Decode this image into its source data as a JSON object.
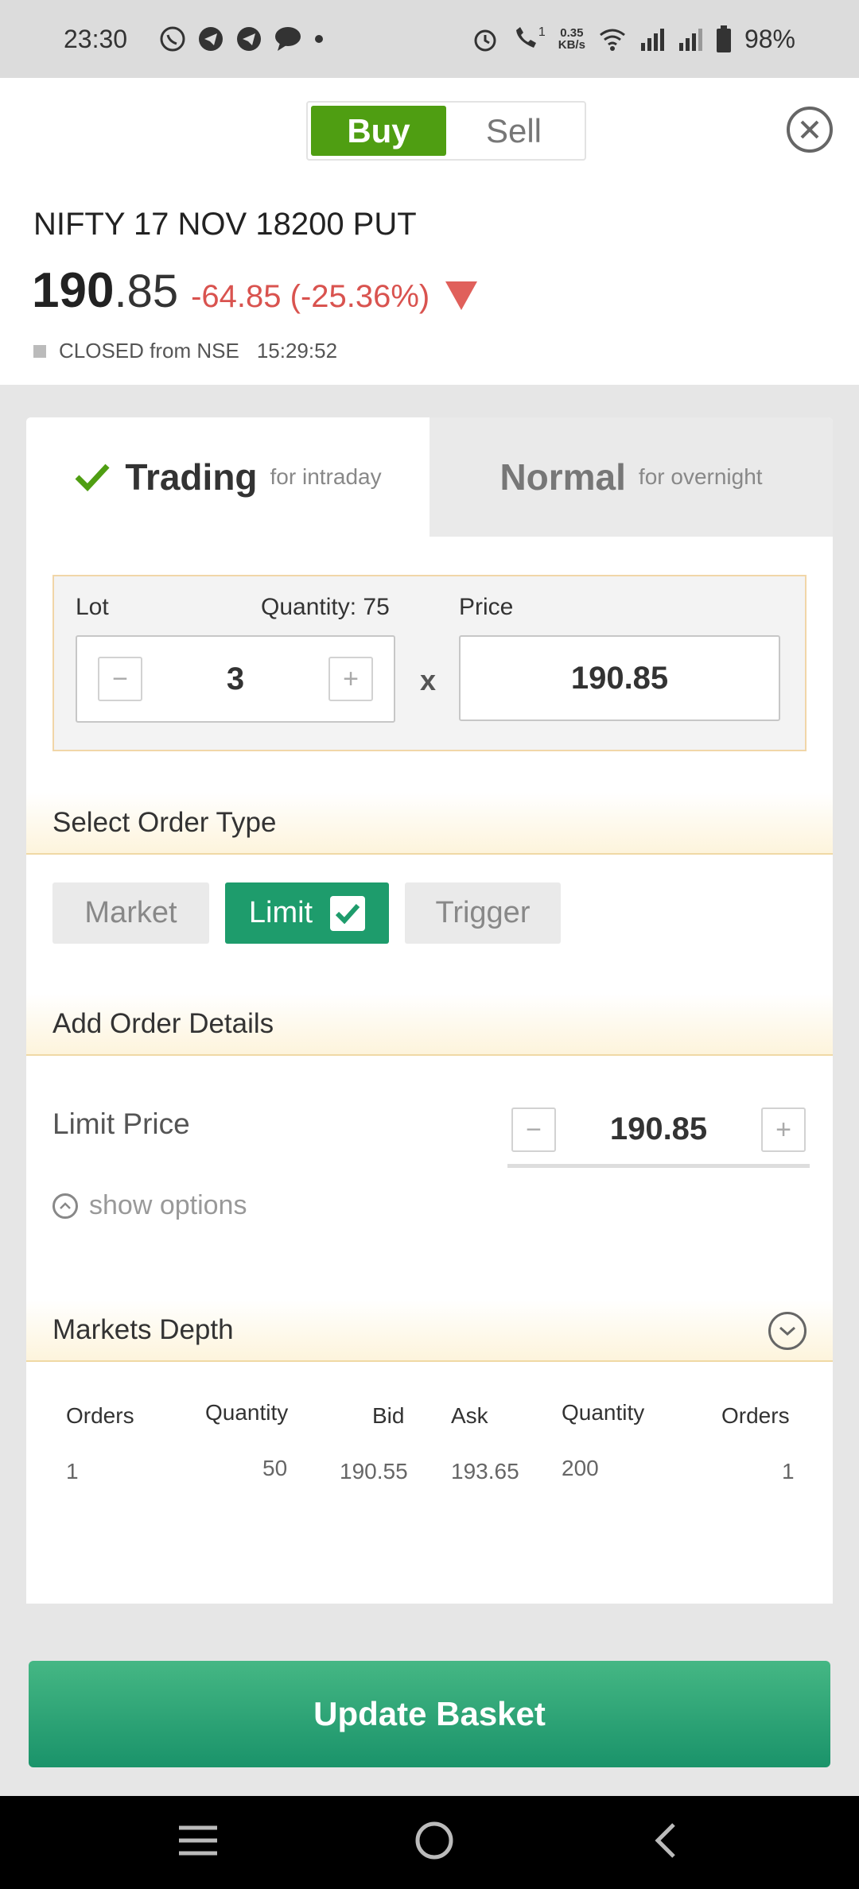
{
  "status_bar": {
    "time": "23:30",
    "net_speed_value": "0.35",
    "net_speed_unit": "KB/s",
    "call_badge": "1",
    "battery": "98%",
    "left_icons": [
      "whatsapp-icon",
      "telegram-icon",
      "telegram-icon",
      "message-icon",
      "dot-icon"
    ],
    "right_icons": [
      "alarm-icon",
      "wifi-call-icon",
      "wifi-icon",
      "signal-icon",
      "signal-icon",
      "battery-icon"
    ]
  },
  "header": {
    "buy_label": "Buy",
    "sell_label": "Sell",
    "selected_side": "Buy",
    "symbol": "NIFTY 17 NOV 18200 PUT",
    "price_int": "190",
    "price_dec": ".85",
    "change": "-64.85 (-25.36%)",
    "market_state": "CLOSED from NSE",
    "market_time": "15:29:52"
  },
  "product_tabs": [
    {
      "label": "Trading",
      "sub": "for intraday",
      "active": true
    },
    {
      "label": "Normal",
      "sub": "for overnight",
      "active": false
    }
  ],
  "quantity": {
    "lot_label": "Lot",
    "quantity_label": "Quantity: 75",
    "price_label": "Price",
    "lot_value": "3",
    "multiply": "x",
    "price_value": "190.85",
    "minus": "−",
    "plus": "+"
  },
  "order_type": {
    "section_title": "Select Order Type",
    "options": [
      "Market",
      "Limit",
      "Trigger"
    ],
    "selected": "Limit"
  },
  "order_details": {
    "section_title": "Add Order Details",
    "limit_price_label": "Limit Price",
    "limit_price_value": "190.85",
    "show_options": "show options"
  },
  "market_depth": {
    "section_title": "Markets Depth",
    "headers": [
      "Orders",
      "Quantity",
      "Bid",
      "Ask",
      "Quantity",
      "Orders"
    ],
    "rows": [
      [
        "1",
        "50",
        "190.55",
        "193.65",
        "200",
        "1"
      ]
    ]
  },
  "actions": {
    "update_basket": "Update Basket"
  },
  "colors": {
    "buy_green": "#4f9e12",
    "loss_red": "#d9534f",
    "primary_green": "#1e9c6c",
    "section_border": "#f0d9a5"
  }
}
